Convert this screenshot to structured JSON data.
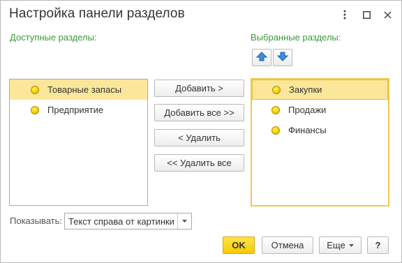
{
  "window": {
    "title": "Настройка панели разделов",
    "menu_icon": "more-vertical-icon",
    "maximize_icon": "maximize-icon",
    "close_icon": "close-icon"
  },
  "available": {
    "label": "Доступные разделы:",
    "items": [
      {
        "label": "Товарные запасы",
        "selected": true
      },
      {
        "label": "Предприятие",
        "selected": false
      }
    ]
  },
  "selected_sections": {
    "label": "Выбранные разделы:",
    "move_up_icon": "arrow-up-icon",
    "move_down_icon": "arrow-down-icon",
    "items": [
      {
        "label": "Закупки",
        "selected": true
      },
      {
        "label": "Продажи",
        "selected": false
      },
      {
        "label": "Финансы",
        "selected": false
      }
    ]
  },
  "actions": {
    "add": "Добавить >",
    "add_all": "Добавить все >>",
    "remove": "< Удалить",
    "remove_all": "<< Удалить все"
  },
  "show": {
    "label": "Показывать:",
    "value": "Текст справа от картинки"
  },
  "footer": {
    "ok": "OK",
    "cancel": "Отмена",
    "more": "Еще",
    "help": "?"
  },
  "colors": {
    "accent_green": "#3a9a3a",
    "selection": "#fbe79a",
    "ok_button": "#f5cb00",
    "arrow_blue": "#3d8fe0"
  }
}
